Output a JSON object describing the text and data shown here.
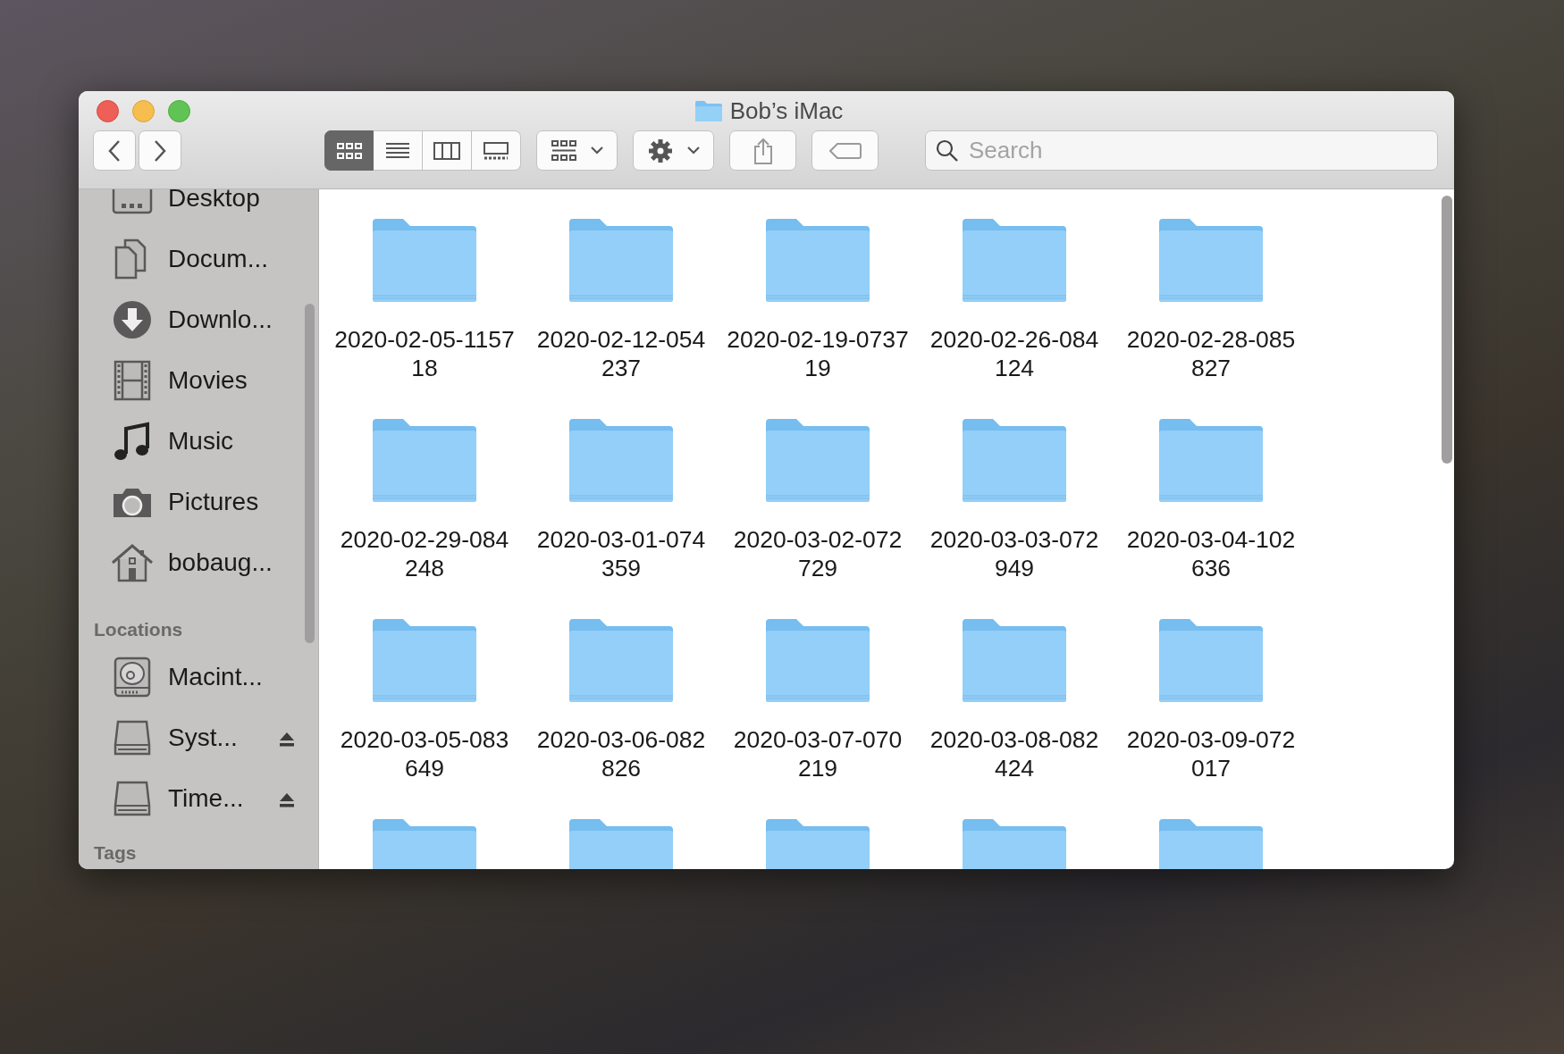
{
  "window": {
    "title": "Bob’s iMac"
  },
  "toolbar": {
    "view_modes": [
      {
        "kind": "icons",
        "selected": true
      },
      {
        "kind": "list",
        "selected": false
      },
      {
        "kind": "columns",
        "selected": false
      },
      {
        "kind": "gallery",
        "selected": false
      }
    ],
    "search": {
      "placeholder": "Search"
    }
  },
  "sidebar": {
    "favorites": [
      {
        "kind": "desktop",
        "label": "Desktop"
      },
      {
        "kind": "documents",
        "label": "Docum..."
      },
      {
        "kind": "downloads",
        "label": "Downlo..."
      },
      {
        "kind": "movies",
        "label": "Movies"
      },
      {
        "kind": "music",
        "label": "Music"
      },
      {
        "kind": "pictures",
        "label": "Pictures"
      },
      {
        "kind": "home",
        "label": "bobaug..."
      }
    ],
    "locations_heading": "Locations",
    "locations": [
      {
        "kind": "hard-disk",
        "label": "Macint...",
        "ejectable": false
      },
      {
        "kind": "drive",
        "label": "Syst...",
        "ejectable": true
      },
      {
        "kind": "drive",
        "label": "Time...",
        "ejectable": true
      }
    ],
    "tags_heading": "Tags"
  },
  "folders": [
    {
      "kind": "folder",
      "name_lines": [
        "2020-02-05-1157",
        "18"
      ]
    },
    {
      "kind": "folder",
      "name_lines": [
        "2020-02-12-054",
        "237"
      ]
    },
    {
      "kind": "folder",
      "name_lines": [
        "2020-02-19-0737",
        "19"
      ]
    },
    {
      "kind": "folder",
      "name_lines": [
        "2020-02-26-084",
        "124"
      ]
    },
    {
      "kind": "folder",
      "name_lines": [
        "2020-02-28-085",
        "827"
      ]
    },
    {
      "kind": "folder",
      "name_lines": [
        "2020-02-29-084",
        "248"
      ]
    },
    {
      "kind": "folder",
      "name_lines": [
        "2020-03-01-074",
        "359"
      ]
    },
    {
      "kind": "folder",
      "name_lines": [
        "2020-03-02-072",
        "729"
      ]
    },
    {
      "kind": "folder",
      "name_lines": [
        "2020-03-03-072",
        "949"
      ]
    },
    {
      "kind": "folder",
      "name_lines": [
        "2020-03-04-102",
        "636"
      ]
    },
    {
      "kind": "folder",
      "name_lines": [
        "2020-03-05-083",
        "649"
      ]
    },
    {
      "kind": "folder",
      "name_lines": [
        "2020-03-06-082",
        "826"
      ]
    },
    {
      "kind": "folder",
      "name_lines": [
        "2020-03-07-070",
        "219"
      ]
    },
    {
      "kind": "folder",
      "name_lines": [
        "2020-03-08-082",
        "424"
      ]
    },
    {
      "kind": "folder",
      "name_lines": [
        "2020-03-09-072",
        "017"
      ]
    },
    {
      "kind": "folder"
    },
    {
      "kind": "folder"
    },
    {
      "kind": "folder"
    },
    {
      "kind": "folder"
    },
    {
      "kind": "folder"
    }
  ]
}
